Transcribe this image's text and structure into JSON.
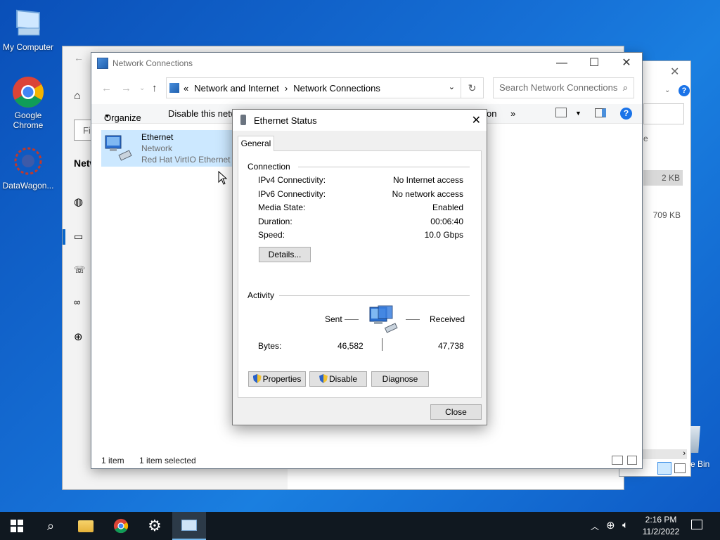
{
  "desktop": {
    "icons": [
      {
        "label": "My Computer",
        "icon": "computer-icon"
      },
      {
        "label": "Google Chrome",
        "icon": "chrome-icon"
      },
      {
        "label": "DataWagon...",
        "icon": "datawagon-icon"
      }
    ]
  },
  "back_window": {
    "nav_partial": "Netw",
    "filter_partial": "Fir"
  },
  "right_window": {
    "partial_e": "e",
    "size1": "2 KB",
    "size2": "709 KB",
    "recycle_partial": "e Bin"
  },
  "explorer": {
    "title": "Network Connections",
    "breadcrumb": [
      "Network and Internet",
      "Network Connections"
    ],
    "breadcrumb_prefix": "«",
    "search_placeholder": "Search Network Connections",
    "toolbar": {
      "organize": "Organize",
      "disable": "Disable this netw",
      "partial_right": "on",
      "more": "»"
    },
    "item": {
      "name": "Ethernet",
      "status": "Network",
      "adapter": "Red Hat VirtIO Ethernet A"
    },
    "status": {
      "count": "1 item",
      "selected": "1 item selected"
    }
  },
  "dialog": {
    "title": "Ethernet Status",
    "tab": "General",
    "connection_label": "Connection",
    "rows": [
      {
        "label": "IPv4 Connectivity:",
        "value": "No Internet access"
      },
      {
        "label": "IPv6 Connectivity:",
        "value": "No network access"
      },
      {
        "label": "Media State:",
        "value": "Enabled"
      },
      {
        "label": "Duration:",
        "value": "00:06:40"
      },
      {
        "label": "Speed:",
        "value": "10.0 Gbps"
      }
    ],
    "details_button": "Details...",
    "activity_label": "Activity",
    "sent_label": "Sent",
    "received_label": "Received",
    "bytes_label": "Bytes:",
    "bytes_sent": "46,582",
    "bytes_received": "47,738",
    "properties_button": "Properties",
    "disable_button": "Disable",
    "diagnose_button": "Diagnose",
    "close_button": "Close"
  },
  "taskbar": {
    "time": "2:16 PM",
    "date": "11/2/2022"
  },
  "colors": {
    "desktop": "#1670d6",
    "selection": "#cce8ff",
    "taskbar": "#101820",
    "link_blue": "#0a66c8"
  }
}
